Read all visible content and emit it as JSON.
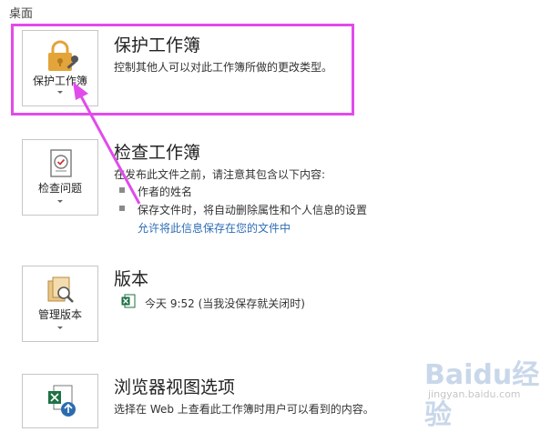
{
  "top_label": "桌面",
  "sections": {
    "protect": {
      "button_label": "保护工作簿",
      "title": "保护工作簿",
      "description": "控制其他人可以对此工作簿所做的更改类型。"
    },
    "inspect": {
      "button_label": "检查问题",
      "title": "检查工作簿",
      "intro": "在发布此文件之前，请注意其包含以下内容:",
      "bullets": [
        "作者的姓名",
        "保存文件时，将自动删除属性和个人信息的设置"
      ],
      "link": "允许将此信息保存在您的文件中"
    },
    "versions": {
      "button_label": "管理版本",
      "title": "版本",
      "entry": "今天 9:52 (当我没保存就关闭时)"
    },
    "browser": {
      "title": "浏览器视图选项",
      "description": "选择在 Web 上查看此工作簿时用户可以看到的内容。"
    }
  },
  "watermark": {
    "logo": "Baidu经验",
    "url": "jingyan.baidu.com"
  },
  "colors": {
    "highlight": "#e14bec",
    "link": "#2e6db4",
    "lock": "#e3a43a"
  }
}
